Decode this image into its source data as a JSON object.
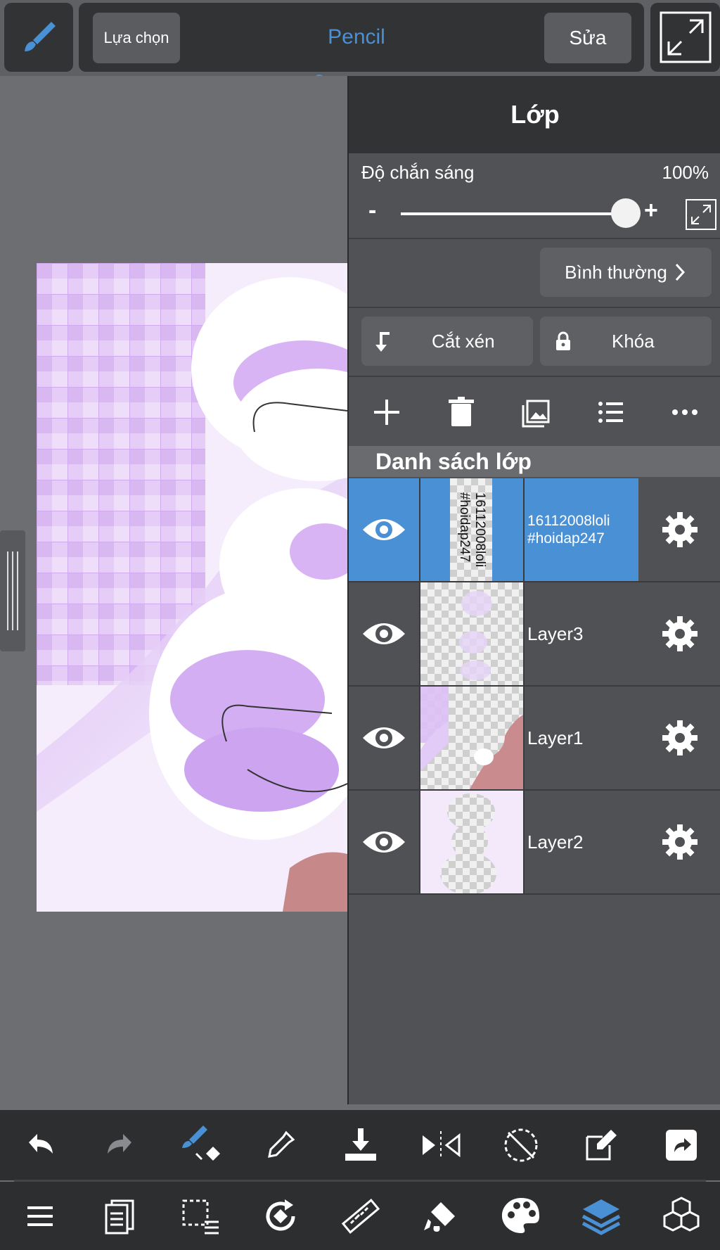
{
  "top_bar": {
    "select_label": "Lựa chọn",
    "tool_name": "Pencil",
    "edit_label": "Sửa"
  },
  "layer_panel": {
    "title": "Lớp",
    "opacity_label": "Độ chắn sáng",
    "opacity_value": "100%",
    "opacity_fraction": 1.0,
    "minus_label": "-",
    "plus_label": "+",
    "blend_mode": "Bình thường",
    "clip_label": "Cắt xén",
    "lock_label": "Khóa",
    "list_header": "Danh sách lớp",
    "layers": [
      {
        "name_line1": "16112008loli",
        "name_line2": "#hoidap247",
        "selected": true,
        "thumb_text_line1": "16112008loli",
        "thumb_text_line2": "#hoidap247"
      },
      {
        "name": "Layer3",
        "selected": false
      },
      {
        "name": "Layer1",
        "selected": false
      },
      {
        "name": "Layer2",
        "selected": false
      }
    ]
  },
  "colors": {
    "accent": "#4a90d4",
    "panel_bg": "#515255",
    "toolbar_bg": "#2d2e30",
    "selected_row": "#4a90d4"
  },
  "icons": {
    "top": [
      "brush-icon",
      "fullscreen-icon"
    ],
    "toolbar1": [
      "undo-icon",
      "redo-icon",
      "brush-transform-icon",
      "eyedropper-icon",
      "save-download-icon",
      "flip-horizontal-icon",
      "rotate-lock-icon",
      "edit-canvas-icon",
      "share-icon"
    ],
    "toolbar2": [
      "menu-icon",
      "pages-icon",
      "selection-icon",
      "rotate-view-icon",
      "ruler-icon",
      "fill-icon",
      "palette-icon",
      "layers-icon",
      "materials-icon"
    ]
  }
}
